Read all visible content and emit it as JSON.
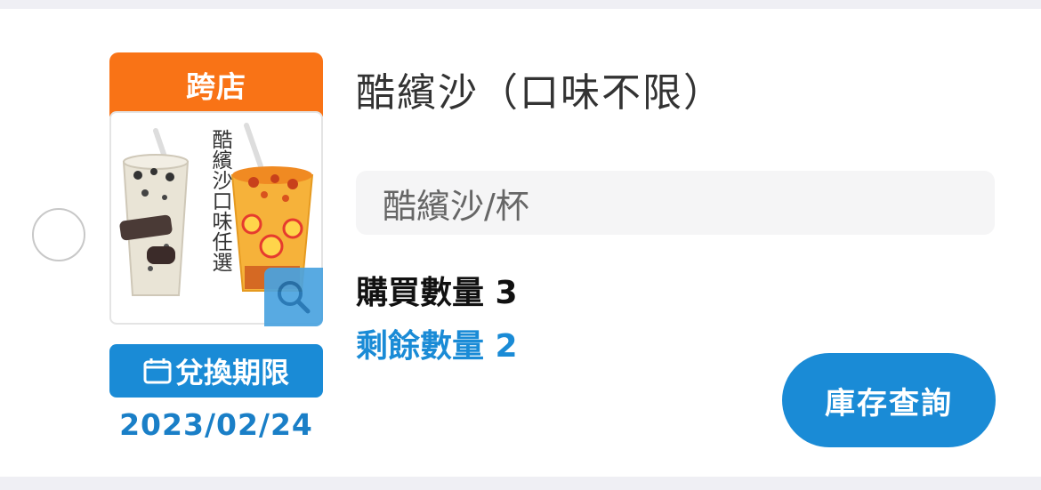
{
  "item": {
    "title": "酷繽沙（口味不限）",
    "tag": "跨店",
    "image_caption": "酷繽沙口味任選",
    "description": "酷繽沙/杯",
    "purchase_qty_label": "購買數量 3",
    "remaining_qty_label": "剩餘數量 2",
    "expiry_label": "兌換期限",
    "expiry_date": "2023/02/24",
    "stock_button_label": "庫存查詢"
  },
  "colors": {
    "tag_bg": "#f97316",
    "accent": "#1a8bd6",
    "date_text": "#1a7fc7",
    "zoom_bg": "#4aa3e0"
  },
  "icons": {
    "calendar": "calendar-icon",
    "zoom": "magnifier-icon"
  }
}
